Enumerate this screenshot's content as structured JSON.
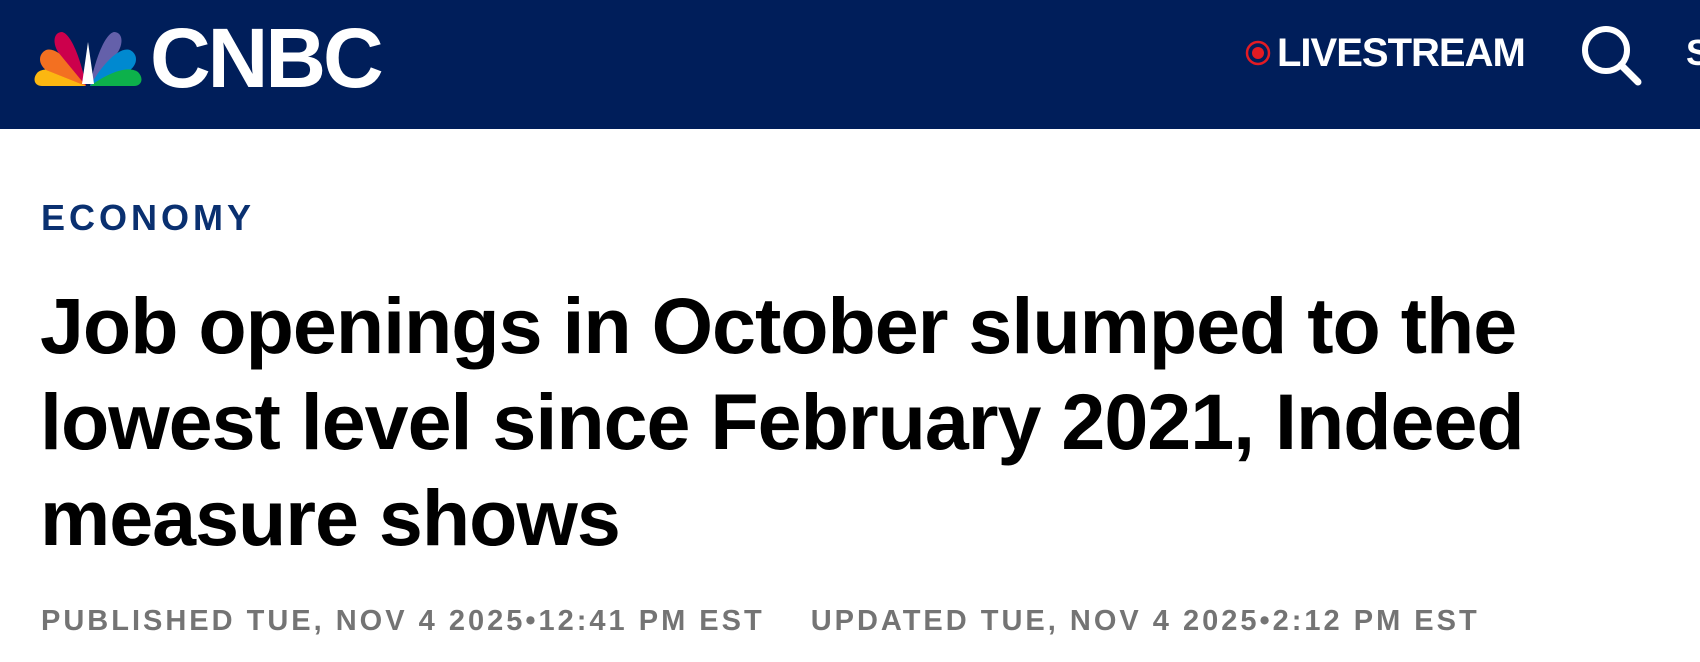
{
  "header": {
    "brand": "CNBC",
    "livestream_label": "LIVESTREAM",
    "edge_text": "S",
    "colors": {
      "background": "#001e5a",
      "live_dot": "#e31b23",
      "text": "#ffffff"
    },
    "icons": [
      "nbc-peacock-icon",
      "live-dot-icon",
      "search-icon"
    ]
  },
  "article": {
    "section": "ECONOMY",
    "headline": "Job openings in October slumped to the lowest level since February 2021, Indeed measure shows",
    "published": "PUBLISHED TUE, NOV 4 2025•12:41 PM EST",
    "updated": "UPDATED TUE, NOV 4 2025•2:12 PM EST",
    "colors": {
      "section": "#0a3070",
      "headline": "#000000",
      "timestamps": "#747474"
    }
  }
}
